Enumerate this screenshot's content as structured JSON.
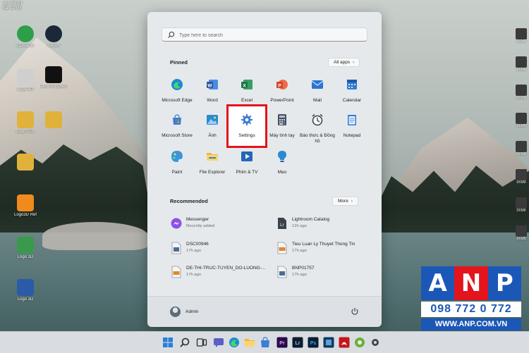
{
  "desktop": {
    "top_text": [
      "sun 20 (F)",
      "Bai 19 (F)"
    ],
    "icons": [
      {
        "label": "CCleaner",
        "color": "#2f9e4b"
      },
      {
        "label": "Steam",
        "color": "#1b2838"
      },
      {
        "label": "Logo 3D",
        "color": "#cfcfcf"
      },
      {
        "label": "Lithis Raspberries",
        "color": "#111111"
      },
      {
        "label": "Logo 3Ds",
        "color": "#e0b23c"
      },
      {
        "label": "",
        "color": "#e0b23c"
      },
      {
        "label": "",
        "color": "#e0b23c"
      },
      {
        "label": "Logo 3Ds Header",
        "color": "#e0b23c"
      },
      {
        "label": "Logo3D Ref",
        "color": "#f08a1c"
      },
      {
        "label": "Logo 3D",
        "color": "#3a9a4b"
      },
      {
        "label": "",
        "color": "#2b5aa8"
      },
      {
        "label": "Logo 3D",
        "color": "#2b5aa8"
      }
    ],
    "right_labels": [
      "0XM0",
      "0XM0",
      "0XM0",
      "0XM0",
      "0XM0",
      "0XM0",
      "0XM0",
      "0XM0",
      "0XM0",
      "0XM0"
    ]
  },
  "start_menu": {
    "search": {
      "placeholder": "Type here to search"
    },
    "pinned": {
      "title": "Pinned",
      "all_apps_label": "All apps",
      "apps": [
        {
          "name": "Microsoft Edge",
          "icon": "edge-icon",
          "color": "#1a8ad4"
        },
        {
          "name": "Word",
          "icon": "word-icon",
          "color": "#2b579a"
        },
        {
          "name": "Excel",
          "icon": "excel-icon",
          "color": "#217346"
        },
        {
          "name": "PowerPoint",
          "icon": "powerpoint-icon",
          "color": "#d24726"
        },
        {
          "name": "Mail",
          "icon": "mail-icon",
          "color": "#2a75d0"
        },
        {
          "name": "Calendar",
          "icon": "calendar-icon",
          "color": "#2f7bd4"
        },
        {
          "name": "Microsoft Store",
          "icon": "store-icon",
          "color": "#3b7dd8"
        },
        {
          "name": "Ảnh",
          "icon": "photos-icon",
          "color": "#2a8bd2"
        },
        {
          "name": "Settings",
          "icon": "settings-gear-icon",
          "color": "#3c7fd0"
        },
        {
          "name": "Máy tính tay",
          "icon": "calculator-icon",
          "color": "#4a4f57"
        },
        {
          "name": "Báo thức & Đồng hồ",
          "icon": "alarm-clock-icon",
          "color": "#3a3f45"
        },
        {
          "name": "Notepad",
          "icon": "notepad-icon",
          "color": "#2f7bd4"
        },
        {
          "name": "Paint",
          "icon": "paint-icon",
          "color": "#2f9be0"
        },
        {
          "name": "File Explorer",
          "icon": "folder-icon",
          "color": "#f2b63a"
        },
        {
          "name": "Phim & TV",
          "icon": "movies-tv-icon",
          "color": "#2466b8"
        },
        {
          "name": "Mẹo",
          "icon": "tips-bulb-icon",
          "color": "#2a8bd2"
        }
      ]
    },
    "recommended": {
      "title": "Recommended",
      "more_label": "More",
      "items": [
        {
          "name": "Messenger",
          "time": "Recently added",
          "icon": "messenger-icon",
          "color": "#8a52e8"
        },
        {
          "name": "Lightroom Catalog",
          "time": "12h ago",
          "icon": "lightroom-file-icon",
          "color": "#3d4148"
        },
        {
          "name": "DSC00946",
          "time": "17h ago",
          "icon": "image-file-icon",
          "color": "#4b6b9b"
        },
        {
          "name": "Tieu Luan Ly Thuyet Thong Tin",
          "time": "17h ago",
          "icon": "pdf-file-icon",
          "color": "#e0892a"
        },
        {
          "name": "DE-THI-TRUC-TUYEN_DO-LUONG-...",
          "time": "17h ago",
          "icon": "pdf-file-icon",
          "color": "#e0892a"
        },
        {
          "name": "BNP01757",
          "time": "17h ago",
          "icon": "image-file-icon",
          "color": "#4b6b9b"
        }
      ]
    },
    "user": {
      "name": "Admin"
    }
  },
  "taskbar": {
    "items": [
      {
        "icon": "windows-start-icon",
        "color": "#2a7fd6"
      },
      {
        "icon": "search-icon",
        "color": "#2b2b2b"
      },
      {
        "icon": "task-view-icon",
        "color": "#2b2b2b"
      },
      {
        "icon": "chat-icon",
        "color": "#5b5fc7"
      },
      {
        "icon": "edge-icon",
        "color": "#1a8ad4"
      },
      {
        "icon": "file-explorer-icon",
        "color": "#f2b63a"
      },
      {
        "icon": "store-icon",
        "color": "#3b7dd8"
      },
      {
        "icon": "premiere-icon",
        "color": "#2a0a48"
      },
      {
        "icon": "lightroom-icon",
        "color": "#0b1d2e"
      },
      {
        "icon": "photoshop-icon",
        "color": "#0b1d2e"
      },
      {
        "icon": "app-icon",
        "color": "#123a5e"
      },
      {
        "icon": "acrobat-icon",
        "color": "#c4161c"
      },
      {
        "icon": "app-icon",
        "color": "#6cae3a"
      },
      {
        "icon": "app-icon",
        "color": "#2e3a45"
      },
      {
        "icon": "settings-icon",
        "color": "#3c4a55"
      }
    ]
  },
  "watermark": {
    "letters": [
      "A",
      "N",
      "P"
    ],
    "colors": [
      "#1b57b7",
      "#e3141c",
      "#1b57b7"
    ],
    "phone": "098 772 0 772",
    "website": "WWW.ANP.COM.VN"
  }
}
